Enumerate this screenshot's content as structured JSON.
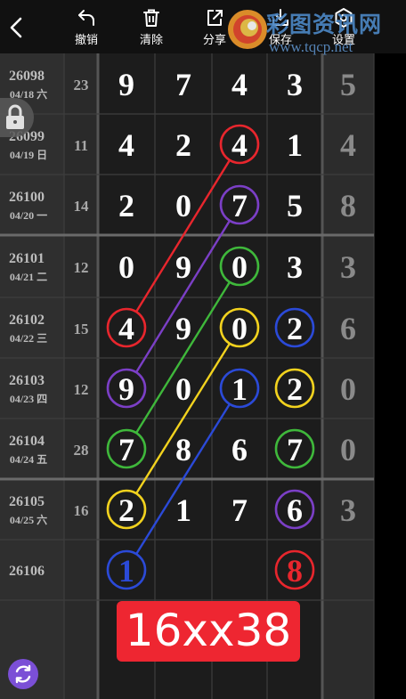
{
  "toolbar": {
    "undo_label": "撤销",
    "clear_label": "清除",
    "share_label": "分享",
    "save_label": "保存",
    "settings_label": "设置"
  },
  "watermark": {
    "name": "彩图资讯网",
    "url": "www.tqcp.net"
  },
  "rows": [
    {
      "issue": "26098",
      "date": "04/18 六",
      "sum": "23",
      "digits": [
        "9",
        "7",
        "4",
        "3"
      ],
      "span": "5"
    },
    {
      "issue": "26099",
      "date": "04/19 日",
      "sum": "11",
      "digits": [
        "4",
        "2",
        "4",
        "1"
      ],
      "span": "4"
    },
    {
      "issue": "26100",
      "date": "04/20 一",
      "sum": "14",
      "digits": [
        "2",
        "0",
        "7",
        "5"
      ],
      "span": "8"
    },
    {
      "issue": "26101",
      "date": "04/21 二",
      "sum": "12",
      "digits": [
        "0",
        "9",
        "0",
        "3"
      ],
      "span": "3"
    },
    {
      "issue": "26102",
      "date": "04/22 三",
      "sum": "15",
      "digits": [
        "4",
        "9",
        "0",
        "2"
      ],
      "span": "6"
    },
    {
      "issue": "26103",
      "date": "04/23 四",
      "sum": "12",
      "digits": [
        "9",
        "0",
        "1",
        "2"
      ],
      "span": "0"
    },
    {
      "issue": "26104",
      "date": "04/24 五",
      "sum": "28",
      "digits": [
        "7",
        "8",
        "6",
        "7"
      ],
      "span": "0"
    },
    {
      "issue": "26105",
      "date": "04/25 六",
      "sum": "16",
      "digits": [
        "2",
        "1",
        "7",
        "6"
      ],
      "span": "3"
    },
    {
      "issue": "26106",
      "date": "",
      "sum": "",
      "digits": [
        "1",
        "",
        "",
        "8"
      ],
      "span": ""
    }
  ],
  "circles": [
    {
      "row": 1,
      "col": 2,
      "color": "#e8262d"
    },
    {
      "row": 2,
      "col": 2,
      "color": "#7b3fc6"
    },
    {
      "row": 3,
      "col": 2,
      "color": "#3fb83b"
    },
    {
      "row": 4,
      "col": 0,
      "color": "#e8262d"
    },
    {
      "row": 4,
      "col": 2,
      "color": "#f2d21e"
    },
    {
      "row": 4,
      "col": 3,
      "color": "#2b4ad8"
    },
    {
      "row": 5,
      "col": 0,
      "color": "#7b3fc6"
    },
    {
      "row": 5,
      "col": 2,
      "color": "#2b4ad8"
    },
    {
      "row": 5,
      "col": 3,
      "color": "#f2d21e"
    },
    {
      "row": 6,
      "col": 0,
      "color": "#3fb83b"
    },
    {
      "row": 6,
      "col": 3,
      "color": "#3fb83b"
    },
    {
      "row": 7,
      "col": 0,
      "color": "#f2d21e"
    },
    {
      "row": 7,
      "col": 3,
      "color": "#7b3fc6"
    },
    {
      "row": 8,
      "col": 0,
      "color": "#2b4ad8"
    },
    {
      "row": 8,
      "col": 3,
      "color": "#e8262d"
    }
  ],
  "lines": [
    {
      "from": [
        1,
        2
      ],
      "to": [
        4,
        0
      ],
      "color": "#e8262d"
    },
    {
      "from": [
        2,
        2
      ],
      "to": [
        5,
        0
      ],
      "color": "#7b3fc6"
    },
    {
      "from": [
        3,
        2
      ],
      "to": [
        6,
        0
      ],
      "color": "#3fb83b"
    },
    {
      "from": [
        4,
        2
      ],
      "to": [
        7,
        0
      ],
      "color": "#f2d21e"
    },
    {
      "from": [
        5,
        2
      ],
      "to": [
        8,
        0
      ],
      "color": "#2b4ad8"
    }
  ],
  "next_digit_colors": {
    "col0": "#2b4ad8",
    "col3": "#e8262d"
  },
  "prediction": "16xx38"
}
